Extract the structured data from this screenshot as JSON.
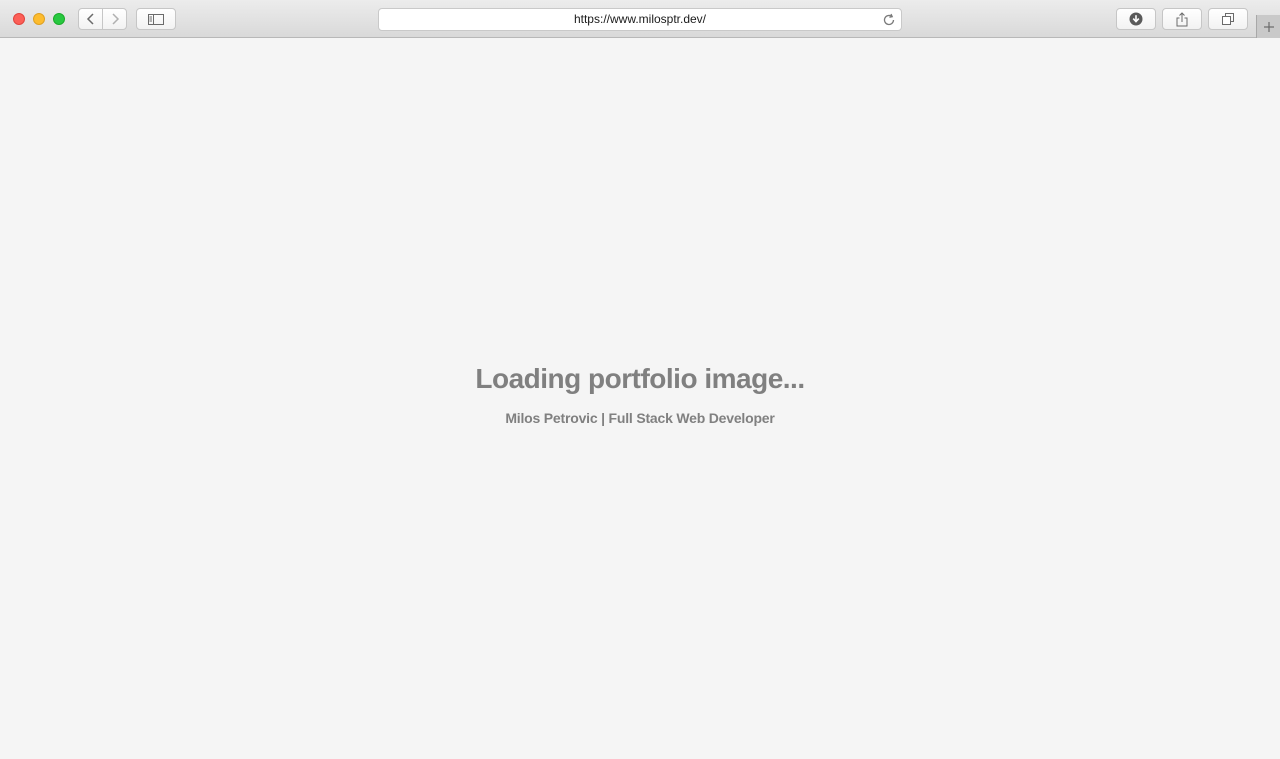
{
  "browser": {
    "url": "https://www.milosptr.dev/",
    "controls": {
      "close_color": "#fc5f57",
      "minimize_color": "#fdbc2e",
      "maximize_color": "#28c840"
    },
    "icons": {
      "back": "chevron-left-icon",
      "forward": "chevron-right-icon",
      "sidebar": "sidebar-icon",
      "reload": "reload-icon",
      "download": "download-icon",
      "share": "share-icon",
      "tabs": "tabs-overview-icon",
      "new_tab": "plus-icon"
    }
  },
  "page": {
    "title": "Loading portfolio image...",
    "subtitle": "Milos Petrovic | Full Stack Web Developer",
    "text_color": "#808080",
    "background_color": "#f5f5f5"
  }
}
